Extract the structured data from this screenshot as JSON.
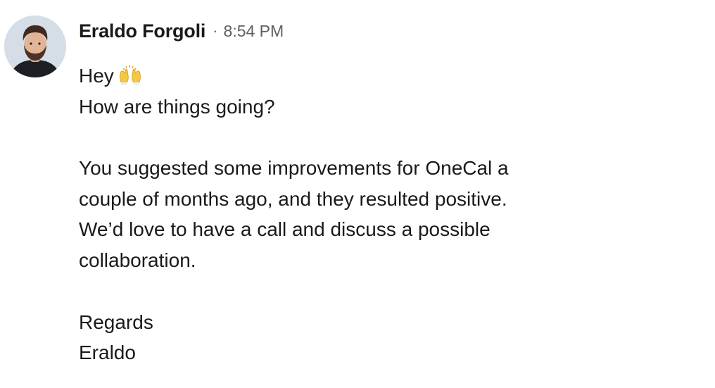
{
  "message": {
    "sender_name": "Eraldo Forgoli",
    "separator": "·",
    "timestamp": "8:54 PM",
    "emoji": "raising-hands-emoji",
    "lines": [
      "Hey",
      "How are things going?",
      "",
      "You suggested some improvements for OneCal a",
      "couple of months ago, and they resulted positive.",
      "We’d love to have a call and discuss a possible",
      "collaboration.",
      "",
      "Regards",
      "Eraldo"
    ]
  },
  "colors": {
    "text": "#1a1a1a",
    "timestamp": "#5f5f5f",
    "avatar_bg": "#d5dde7",
    "emoji": "#f5c842"
  }
}
